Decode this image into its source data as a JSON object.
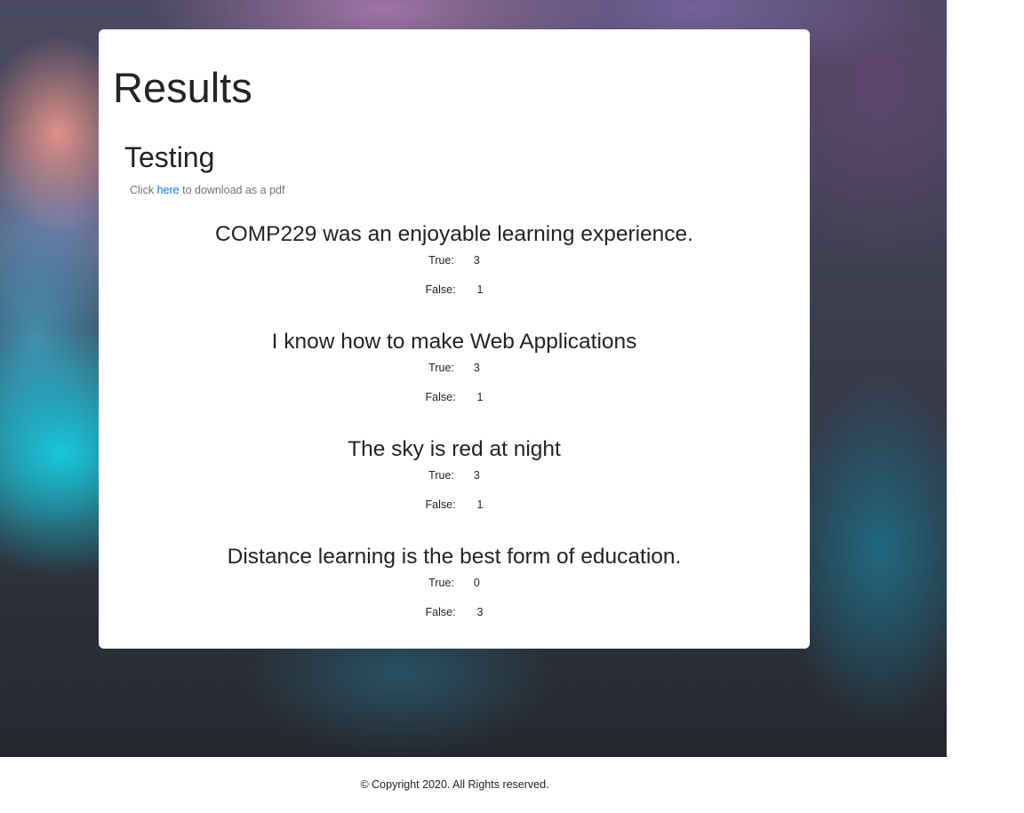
{
  "page": {
    "title": "Results"
  },
  "survey": {
    "title": "Testing",
    "download_prefix": "Click",
    "download_link": "here",
    "download_suffix": "to download as a pdf"
  },
  "questions": [
    {
      "text": "COMP229 was an enjoyable learning experience.",
      "true_label": "True:",
      "true_count": "3",
      "false_label": "False:",
      "false_count": "1"
    },
    {
      "text": "I know how to make Web Applications",
      "true_label": "True:",
      "true_count": "3",
      "false_label": "False:",
      "false_count": "1"
    },
    {
      "text": "The sky is red at night",
      "true_label": "True:",
      "true_count": "3",
      "false_label": "False:",
      "false_count": "1"
    },
    {
      "text": "Distance learning is the best form of education.",
      "true_label": "True:",
      "true_count": "0",
      "false_label": "False:",
      "false_count": "3"
    }
  ],
  "footer": {
    "text": "© Copyright 2020. All Rights reserved."
  },
  "colors": {
    "link": "#007bff",
    "text": "#212529",
    "muted": "#6c757d"
  }
}
